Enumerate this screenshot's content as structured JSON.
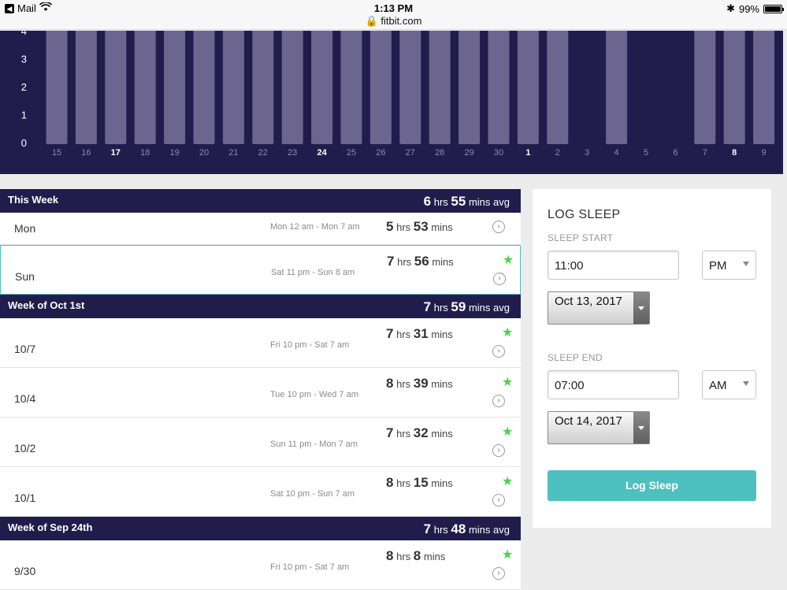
{
  "status_bar": {
    "back_app": "Mail",
    "time": "1:13 PM",
    "url": "fitbit.com",
    "battery": "99%",
    "battery_level": 0.99
  },
  "chart_data": {
    "type": "bar",
    "categories": [
      "15",
      "16",
      "17",
      "18",
      "19",
      "20",
      "21",
      "22",
      "23",
      "24",
      "25",
      "26",
      "27",
      "28",
      "29",
      "30",
      "1",
      "2",
      "3",
      "4",
      "5",
      "6",
      "7",
      "8",
      "9"
    ],
    "bold_categories": [
      "17",
      "24",
      "1",
      "8"
    ],
    "values": [
      4.2,
      4.2,
      4.2,
      4.2,
      4.2,
      4.2,
      4.2,
      4.2,
      4.2,
      4.2,
      4.2,
      4.2,
      4.2,
      4.2,
      4.2,
      4.2,
      4.2,
      4.2,
      0,
      4.2,
      0,
      0,
      4.2,
      4.2,
      4.2
    ],
    "y_ticks": [
      "0",
      "1",
      "2",
      "3",
      "4"
    ],
    "ylim": [
      0,
      4.2
    ],
    "bar_color": "#6b6590",
    "background": "#221c4d"
  },
  "weeks": [
    {
      "title": "This Week",
      "avg_hrs": "6",
      "avg_mins": "55",
      "rows": [
        {
          "day": "Mon",
          "range": "Mon 12 am - Mon 7 am",
          "hrs": "5",
          "mins": "53",
          "star": false,
          "highlight": false
        },
        {
          "day": "Sun",
          "range": "Sat 11 pm - Sun 8 am",
          "hrs": "7",
          "mins": "56",
          "star": true,
          "highlight": true
        }
      ]
    },
    {
      "title": "Week of Oct 1st",
      "avg_hrs": "7",
      "avg_mins": "59",
      "rows": [
        {
          "day": "10/7",
          "range": "Fri 10 pm - Sat 7 am",
          "hrs": "7",
          "mins": "31",
          "star": true,
          "highlight": false
        },
        {
          "day": "10/4",
          "range": "Tue 10 pm - Wed 7 am",
          "hrs": "8",
          "mins": "39",
          "star": true,
          "highlight": false
        },
        {
          "day": "10/2",
          "range": "Sun 11 pm - Mon 7 am",
          "hrs": "7",
          "mins": "32",
          "star": true,
          "highlight": false
        },
        {
          "day": "10/1",
          "range": "Sat 10 pm - Sun 7 am",
          "hrs": "8",
          "mins": "15",
          "star": true,
          "highlight": false
        }
      ]
    },
    {
      "title": "Week of Sep 24th",
      "avg_hrs": "7",
      "avg_mins": "48",
      "rows": [
        {
          "day": "9/30",
          "range": "Fri 10 pm - Sat 7 am",
          "hrs": "8",
          "mins": "8",
          "star": true,
          "highlight": false
        }
      ]
    }
  ],
  "units": {
    "hrs": "hrs",
    "mins": "mins",
    "avg": "avg"
  },
  "log_sleep": {
    "title": "LOG SLEEP",
    "start_label": "SLEEP START",
    "start_time": "11:00",
    "start_ampm": "PM",
    "start_date": "Oct 13, 2017",
    "end_label": "SLEEP END",
    "end_time": "07:00",
    "end_ampm": "AM",
    "end_date": "Oct 14, 2017",
    "button": "Log Sleep"
  },
  "colors": {
    "accent": "#4ec0c0",
    "star": "#4bd24b",
    "header": "#221c4d"
  }
}
